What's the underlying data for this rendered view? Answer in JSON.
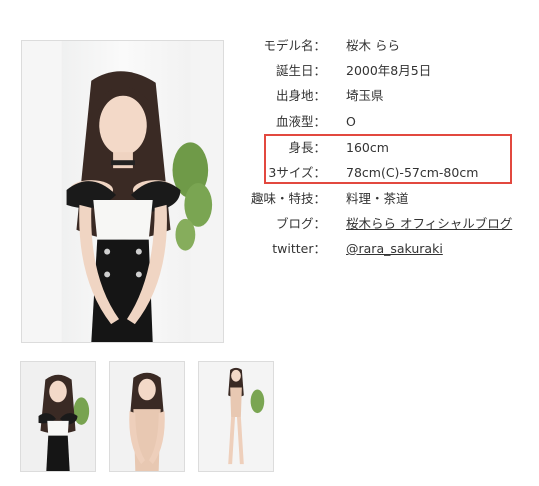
{
  "profile": {
    "name": {
      "label": "モデル名：",
      "value": "桜木 らら"
    },
    "birthday": {
      "label": "誕生日：",
      "value": "2000年8月5日"
    },
    "birthplace": {
      "label": "出身地：",
      "value": "埼玉県"
    },
    "blood_type": {
      "label": "血液型：",
      "value": "O"
    },
    "height": {
      "label": "身長：",
      "value": "160cm"
    },
    "measurements": {
      "label": "3サイズ：",
      "value": "78cm(C)-57cm-80cm"
    },
    "hobbies": {
      "label": "趣味・特技：",
      "value": "料理・茶道"
    },
    "blog": {
      "label": "ブログ：",
      "value": "桜木らら オフィシャルブログ"
    },
    "twitter": {
      "label": "twitter：",
      "value": "@rara_sakuraki"
    }
  },
  "colors": {
    "highlight_border": "#e2483f",
    "text": "#333333",
    "image_border": "#dcdcdc"
  }
}
